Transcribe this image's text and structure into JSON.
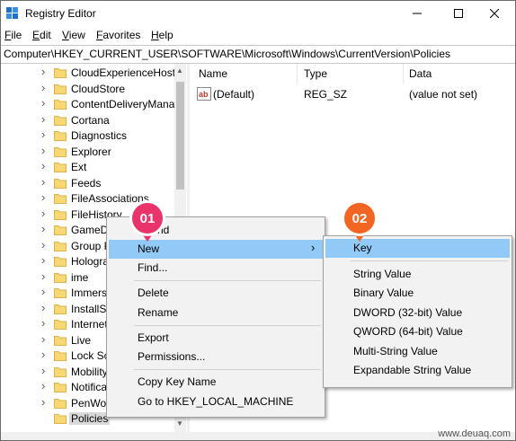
{
  "window": {
    "title": "Registry Editor"
  },
  "menu": [
    "File",
    "Edit",
    "View",
    "Favorites",
    "Help"
  ],
  "address": "Computer\\HKEY_CURRENT_USER\\SOFTWARE\\Microsoft\\Windows\\CurrentVersion\\Policies",
  "tree": [
    {
      "label": "CloudExperienceHost"
    },
    {
      "label": "CloudStore"
    },
    {
      "label": "ContentDeliveryMana"
    },
    {
      "label": "Cortana"
    },
    {
      "label": "Diagnostics"
    },
    {
      "label": "Explorer"
    },
    {
      "label": "Ext"
    },
    {
      "label": "Feeds"
    },
    {
      "label": "FileAssociations"
    },
    {
      "label": "FileHistory"
    },
    {
      "label": "GameDV"
    },
    {
      "label": "Group P"
    },
    {
      "label": "Hologra"
    },
    {
      "label": "ime"
    },
    {
      "label": "Immers"
    },
    {
      "label": "InstallSe"
    },
    {
      "label": "Internet"
    },
    {
      "label": "Live"
    },
    {
      "label": "Lock Sc"
    },
    {
      "label": "Mobility"
    },
    {
      "label": "Notifica"
    },
    {
      "label": "PenWor"
    },
    {
      "label": "Policies"
    }
  ],
  "columns": {
    "name": "Name",
    "type": "Type",
    "data": "Data"
  },
  "values": [
    {
      "name": "(Default)",
      "type": "REG_SZ",
      "data": "(value not set)"
    }
  ],
  "context_menu": {
    "partial_label": "nd",
    "items": [
      {
        "label": "New"
      },
      {
        "label": "Find..."
      },
      {
        "label": "Delete"
      },
      {
        "label": "Rename"
      },
      {
        "label": "Export"
      },
      {
        "label": "Permissions..."
      },
      {
        "label": "Copy Key Name"
      },
      {
        "label": "Go to HKEY_LOCAL_MACHINE"
      }
    ],
    "submenu_arrow": "›"
  },
  "submenu": {
    "items": [
      {
        "label": "Key"
      },
      {
        "label": "String Value"
      },
      {
        "label": "Binary Value"
      },
      {
        "label": "DWORD (32-bit) Value"
      },
      {
        "label": "QWORD (64-bit) Value"
      },
      {
        "label": "Multi-String Value"
      },
      {
        "label": "Expandable String Value"
      }
    ]
  },
  "badges": [
    {
      "label": "01",
      "color": "#e8336b"
    },
    {
      "label": "02",
      "color": "#f26522"
    }
  ],
  "watermark": "www.deuaq.com",
  "colors": {
    "highlight": "#91c9f7",
    "folder": "#f8d775",
    "folder_edge": "#dcb24a",
    "selection": "#d9d9d9"
  }
}
